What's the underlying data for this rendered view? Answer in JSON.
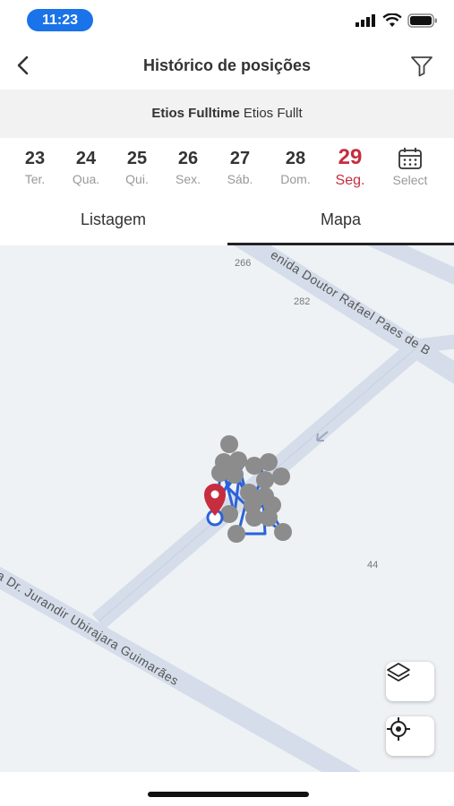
{
  "status_bar": {
    "time": "11:23"
  },
  "header": {
    "title": "Histórico de posições"
  },
  "vehicle": {
    "name": "Etios Fulltime",
    "plate": "Etios Fullt"
  },
  "dates": [
    {
      "num": "23",
      "day": "Ter."
    },
    {
      "num": "24",
      "day": "Qua."
    },
    {
      "num": "25",
      "day": "Qui."
    },
    {
      "num": "26",
      "day": "Sex."
    },
    {
      "num": "27",
      "day": "Sáb."
    },
    {
      "num": "28",
      "day": "Dom."
    },
    {
      "num": "29",
      "day": "Seg.",
      "selected": true
    }
  ],
  "select_label": "Select",
  "tabs": [
    {
      "label": "Listagem"
    },
    {
      "label": "Mapa",
      "active": true
    }
  ],
  "map": {
    "labels": [
      "266",
      "282",
      "44"
    ],
    "streets": [
      "enida Doutor Rafael Paes de B",
      "a Dr. Jurandir Ubirajara Guimarães"
    ],
    "icons": [
      "layers-icon",
      "locate-icon",
      "location-pin-icon",
      "direction-arrow-icon"
    ]
  },
  "colors": {
    "accent": "#1a73e8",
    "selected": "#c62d3e",
    "route": "#2b62d9",
    "marker": "#8c8c8c",
    "road": "#d5ddea"
  }
}
